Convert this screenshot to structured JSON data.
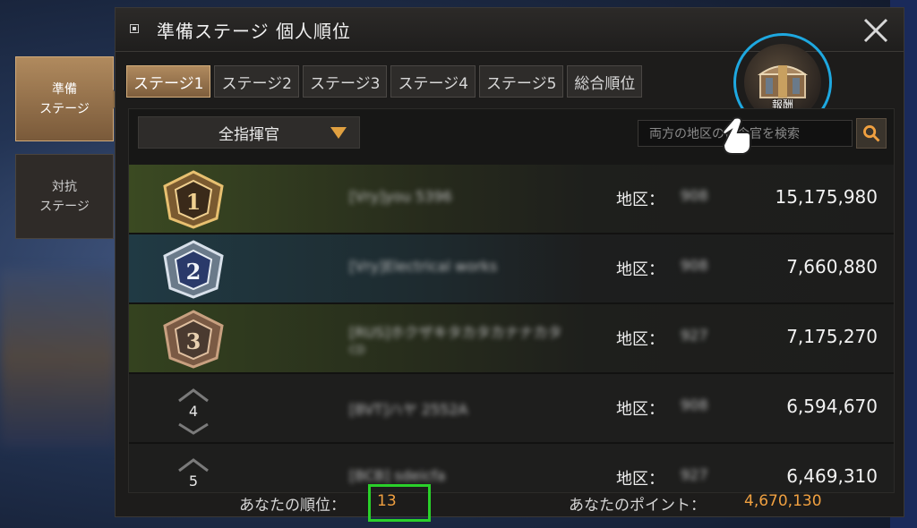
{
  "side_tabs": [
    {
      "line1": "準備",
      "line2": "ステージ"
    },
    {
      "line1": "対抗",
      "line2": "ステージ"
    }
  ],
  "header": {
    "title": "準備ステージ 個人順位"
  },
  "tabs": [
    "ステージ1",
    "ステージ2",
    "ステージ3",
    "ステージ4",
    "ステージ5",
    "総合順位"
  ],
  "reward": {
    "label": "報酬"
  },
  "filter": {
    "selected": "全指揮官"
  },
  "search": {
    "placeholder": "両方の地区の司令官を検索"
  },
  "rows": [
    {
      "rank": "1",
      "name": "[Vry]you 5396",
      "name_sub": "",
      "region_label": "地区：",
      "region": "908",
      "points": "15,175,980"
    },
    {
      "rank": "2",
      "name": "[Vry]Electrical works",
      "name_sub": "",
      "region_label": "地区：",
      "region": "908",
      "points": "7,660,880"
    },
    {
      "rank": "3",
      "name": "[RUS]ホクザキタカタカナナカタ",
      "name_sub": "CD",
      "region_label": "地区：",
      "region": "927",
      "points": "7,175,270"
    },
    {
      "rank": "4",
      "name": "[BVT]ハヤ 2552A",
      "name_sub": "",
      "region_label": "地区：",
      "region": "908",
      "points": "6,594,670"
    },
    {
      "rank": "5",
      "name": "[BCB] sdeicfa",
      "name_sub": "",
      "region_label": "地区：",
      "region": "927",
      "points": "6,469,310"
    }
  ],
  "footer": {
    "rank_label": "あなたの順位：",
    "rank_value": "13",
    "points_label": "あなたのポイント：",
    "points_value": "4,670,130"
  },
  "colors": {
    "accent_orange": "#f0a040",
    "highlight_blue": "#1ea8e0",
    "highlight_green": "#2ad02a"
  }
}
